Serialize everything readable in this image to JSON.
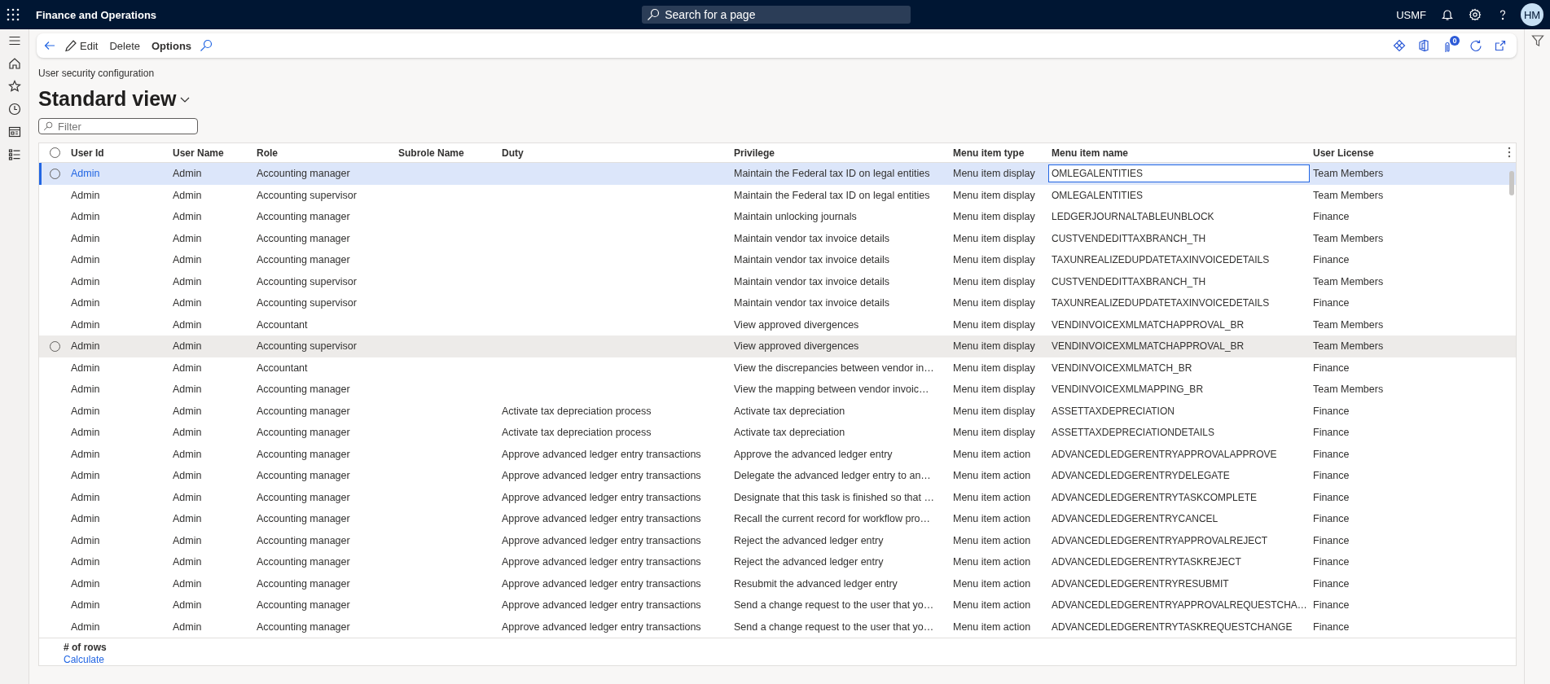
{
  "top_bar": {
    "app_title": "Finance and Operations",
    "search": {
      "placeholder": "Search for a page"
    },
    "company": "USMF",
    "avatar_initials": "HM"
  },
  "action_pane": {
    "buttons": [
      {
        "label": "Edit",
        "kind": "icon"
      },
      {
        "label": "Delete",
        "kind": "plain"
      },
      {
        "label": "Options",
        "kind": "bold"
      }
    ],
    "attachments_count": "0"
  },
  "page": {
    "breadcrumb": "User security configuration",
    "view_title": "Standard view",
    "filter": {
      "placeholder": "Filter"
    }
  },
  "table": {
    "all_selected": false,
    "columns": [
      "User Id",
      "User Name",
      "Role",
      "Subrole Name",
      "Duty",
      "Privilege",
      "Menu item type",
      "Menu item name",
      "User License"
    ],
    "rows": [
      {
        "selected": true,
        "hovered": false,
        "name_cell_focused": true,
        "user_id": "Admin",
        "user_name": "Admin",
        "role": "Accounting manager",
        "privilege": "Maintain the Federal tax ID on legal entities",
        "menu_item_type": "Menu item display",
        "menu_item_name": "OMLEGALENTITIES",
        "user_license": "Team Members"
      },
      {
        "selected": false,
        "hovered": false,
        "name_cell_focused": false,
        "user_id": "Admin",
        "user_name": "Admin",
        "role": "Accounting supervisor",
        "privilege": "Maintain the Federal tax ID on legal entities",
        "menu_item_type": "Menu item display",
        "menu_item_name": "OMLEGALENTITIES",
        "user_license": "Team Members"
      },
      {
        "selected": false,
        "hovered": false,
        "name_cell_focused": false,
        "user_id": "Admin",
        "user_name": "Admin",
        "role": "Accounting manager",
        "privilege": "Maintain unlocking journals",
        "menu_item_type": "Menu item display",
        "menu_item_name": "LEDGERJOURNALTABLEUNBLOCK",
        "user_license": "Finance"
      },
      {
        "selected": false,
        "hovered": false,
        "name_cell_focused": false,
        "user_id": "Admin",
        "user_name": "Admin",
        "role": "Accounting manager",
        "privilege": "Maintain vendor tax invoice details",
        "menu_item_type": "Menu item display",
        "menu_item_name": "CUSTVENDEDITTAXBRANCH_TH",
        "user_license": "Team Members"
      },
      {
        "selected": false,
        "hovered": false,
        "name_cell_focused": false,
        "user_id": "Admin",
        "user_name": "Admin",
        "role": "Accounting manager",
        "privilege": "Maintain vendor tax invoice details",
        "menu_item_type": "Menu item display",
        "menu_item_name": "TAXUNREALIZEDUPDATETAXINVOICEDETAILS",
        "user_license": "Finance"
      },
      {
        "selected": false,
        "hovered": false,
        "name_cell_focused": false,
        "user_id": "Admin",
        "user_name": "Admin",
        "role": "Accounting supervisor",
        "privilege": "Maintain vendor tax invoice details",
        "menu_item_type": "Menu item display",
        "menu_item_name": "CUSTVENDEDITTAXBRANCH_TH",
        "user_license": "Team Members"
      },
      {
        "selected": false,
        "hovered": false,
        "name_cell_focused": false,
        "user_id": "Admin",
        "user_name": "Admin",
        "role": "Accounting supervisor",
        "privilege": "Maintain vendor tax invoice details",
        "menu_item_type": "Menu item display",
        "menu_item_name": "TAXUNREALIZEDUPDATETAXINVOICEDETAILS",
        "user_license": "Finance"
      },
      {
        "selected": false,
        "hovered": false,
        "name_cell_focused": false,
        "user_id": "Admin",
        "user_name": "Admin",
        "role": "Accountant",
        "privilege": "View approved divergences",
        "menu_item_type": "Menu item display",
        "menu_item_name": "VENDINVOICEXMLMATCHAPPROVAL_BR",
        "user_license": "Team Members"
      },
      {
        "selected": false,
        "hovered": true,
        "name_cell_focused": false,
        "user_id": "Admin",
        "user_name": "Admin",
        "role": "Accounting supervisor",
        "privilege": "View approved divergences",
        "menu_item_type": "Menu item display",
        "menu_item_name": "VENDINVOICEXMLMATCHAPPROVAL_BR",
        "user_license": "Team Members"
      },
      {
        "selected": false,
        "hovered": false,
        "name_cell_focused": false,
        "user_id": "Admin",
        "user_name": "Admin",
        "role": "Accountant",
        "privilege": "View the discrepancies between vendor in…",
        "menu_item_type": "Menu item display",
        "menu_item_name": "VENDINVOICEXMLMATCH_BR",
        "user_license": "Finance"
      },
      {
        "selected": false,
        "hovered": false,
        "name_cell_focused": false,
        "user_id": "Admin",
        "user_name": "Admin",
        "role": "Accounting manager",
        "privilege": "View the mapping between vendor invoic…",
        "menu_item_type": "Menu item display",
        "menu_item_name": "VENDINVOICEXMLMAPPING_BR",
        "user_license": "Team Members"
      },
      {
        "selected": false,
        "hovered": false,
        "name_cell_focused": false,
        "user_id": "Admin",
        "user_name": "Admin",
        "role": "Accounting manager",
        "duty": "Activate tax depreciation process",
        "privilege": "Activate tax depreciation",
        "menu_item_type": "Menu item display",
        "menu_item_name": "ASSETTAXDEPRECIATION",
        "user_license": "Finance"
      },
      {
        "selected": false,
        "hovered": false,
        "name_cell_focused": false,
        "user_id": "Admin",
        "user_name": "Admin",
        "role": "Accounting manager",
        "duty": "Activate tax depreciation process",
        "privilege": "Activate tax depreciation",
        "menu_item_type": "Menu item display",
        "menu_item_name": "ASSETTAXDEPRECIATIONDETAILS",
        "user_license": "Finance"
      },
      {
        "selected": false,
        "hovered": false,
        "name_cell_focused": false,
        "user_id": "Admin",
        "user_name": "Admin",
        "role": "Accounting manager",
        "duty": "Approve advanced ledger entry transactions",
        "privilege": "Approve the advanced ledger entry",
        "menu_item_type": "Menu item action",
        "menu_item_name": "ADVANCEDLEDGERENTRYAPPROVALAPPROVE",
        "user_license": "Finance"
      },
      {
        "selected": false,
        "hovered": false,
        "name_cell_focused": false,
        "user_id": "Admin",
        "user_name": "Admin",
        "role": "Accounting manager",
        "duty": "Approve advanced ledger entry transactions",
        "privilege": "Delegate the advanced ledger entry to an…",
        "menu_item_type": "Menu item action",
        "menu_item_name": "ADVANCEDLEDGERENTRYDELEGATE",
        "user_license": "Finance"
      },
      {
        "selected": false,
        "hovered": false,
        "name_cell_focused": false,
        "user_id": "Admin",
        "user_name": "Admin",
        "role": "Accounting manager",
        "duty": "Approve advanced ledger entry transactions",
        "privilege": "Designate that this task is finished so that …",
        "menu_item_type": "Menu item action",
        "menu_item_name": "ADVANCEDLEDGERENTRYTASKCOMPLETE",
        "user_license": "Finance"
      },
      {
        "selected": false,
        "hovered": false,
        "name_cell_focused": false,
        "user_id": "Admin",
        "user_name": "Admin",
        "role": "Accounting manager",
        "duty": "Approve advanced ledger entry transactions",
        "privilege": "Recall the current record for workflow pro…",
        "menu_item_type": "Menu item action",
        "menu_item_name": "ADVANCEDLEDGERENTRYCANCEL",
        "user_license": "Finance"
      },
      {
        "selected": false,
        "hovered": false,
        "name_cell_focused": false,
        "user_id": "Admin",
        "user_name": "Admin",
        "role": "Accounting manager",
        "duty": "Approve advanced ledger entry transactions",
        "privilege": "Reject the advanced ledger entry",
        "menu_item_type": "Menu item action",
        "menu_item_name": "ADVANCEDLEDGERENTRYAPPROVALREJECT",
        "user_license": "Finance"
      },
      {
        "selected": false,
        "hovered": false,
        "name_cell_focused": false,
        "user_id": "Admin",
        "user_name": "Admin",
        "role": "Accounting manager",
        "duty": "Approve advanced ledger entry transactions",
        "privilege": "Reject the advanced ledger entry",
        "menu_item_type": "Menu item action",
        "menu_item_name": "ADVANCEDLEDGERENTRYTASKREJECT",
        "user_license": "Finance"
      },
      {
        "selected": false,
        "hovered": false,
        "name_cell_focused": false,
        "user_id": "Admin",
        "user_name": "Admin",
        "role": "Accounting manager",
        "duty": "Approve advanced ledger entry transactions",
        "privilege": "Resubmit the advanced ledger entry",
        "menu_item_type": "Menu item action",
        "menu_item_name": "ADVANCEDLEDGERENTRYRESUBMIT",
        "user_license": "Finance"
      },
      {
        "selected": false,
        "hovered": false,
        "name_cell_focused": false,
        "user_id": "Admin",
        "user_name": "Admin",
        "role": "Accounting manager",
        "duty": "Approve advanced ledger entry transactions",
        "privilege": "Send a change request to the user that yo…",
        "menu_item_type": "Menu item action",
        "menu_item_name": "ADVANCEDLEDGERENTRYAPPROVALREQUESTCHA…",
        "user_license": "Finance"
      },
      {
        "selected": false,
        "hovered": false,
        "name_cell_focused": false,
        "user_id": "Admin",
        "user_name": "Admin",
        "role": "Accounting manager",
        "duty": "Approve advanced ledger entry transactions",
        "privilege": "Send a change request to the user that yo…",
        "menu_item_type": "Menu item action",
        "menu_item_name": "ADVANCEDLEDGERENTRYTASKREQUESTCHANGE",
        "user_license": "Finance"
      }
    ],
    "footer": {
      "label": "# of rows",
      "link": "Calculate"
    }
  }
}
